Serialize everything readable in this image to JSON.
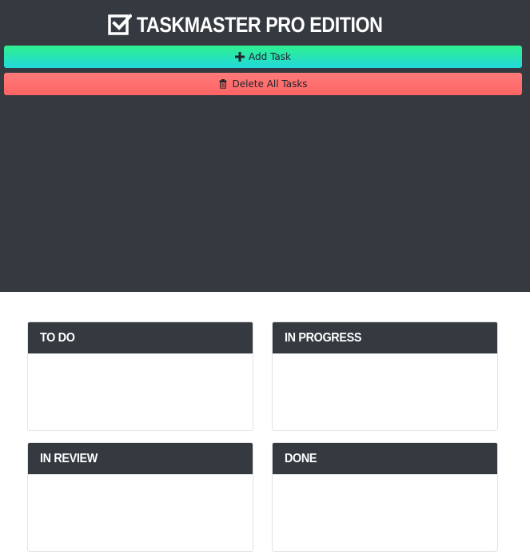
{
  "app": {
    "title": "TASKMASTER PRO EDITION"
  },
  "toolbar": {
    "add_label": "Add Task",
    "delete_label": "Delete All Tasks"
  },
  "columns": [
    {
      "title": "TO DO"
    },
    {
      "title": "IN PROGRESS"
    },
    {
      "title": "IN REVIEW"
    },
    {
      "title": "DONE"
    }
  ],
  "colors": {
    "header_bg": "#343a40",
    "add_button": "#2fe9b4",
    "delete_button": "#ff6e6e"
  },
  "icons": {
    "title_icon": "checkbox-icon",
    "add_icon": "plus-icon",
    "delete_icon": "trash-icon"
  }
}
